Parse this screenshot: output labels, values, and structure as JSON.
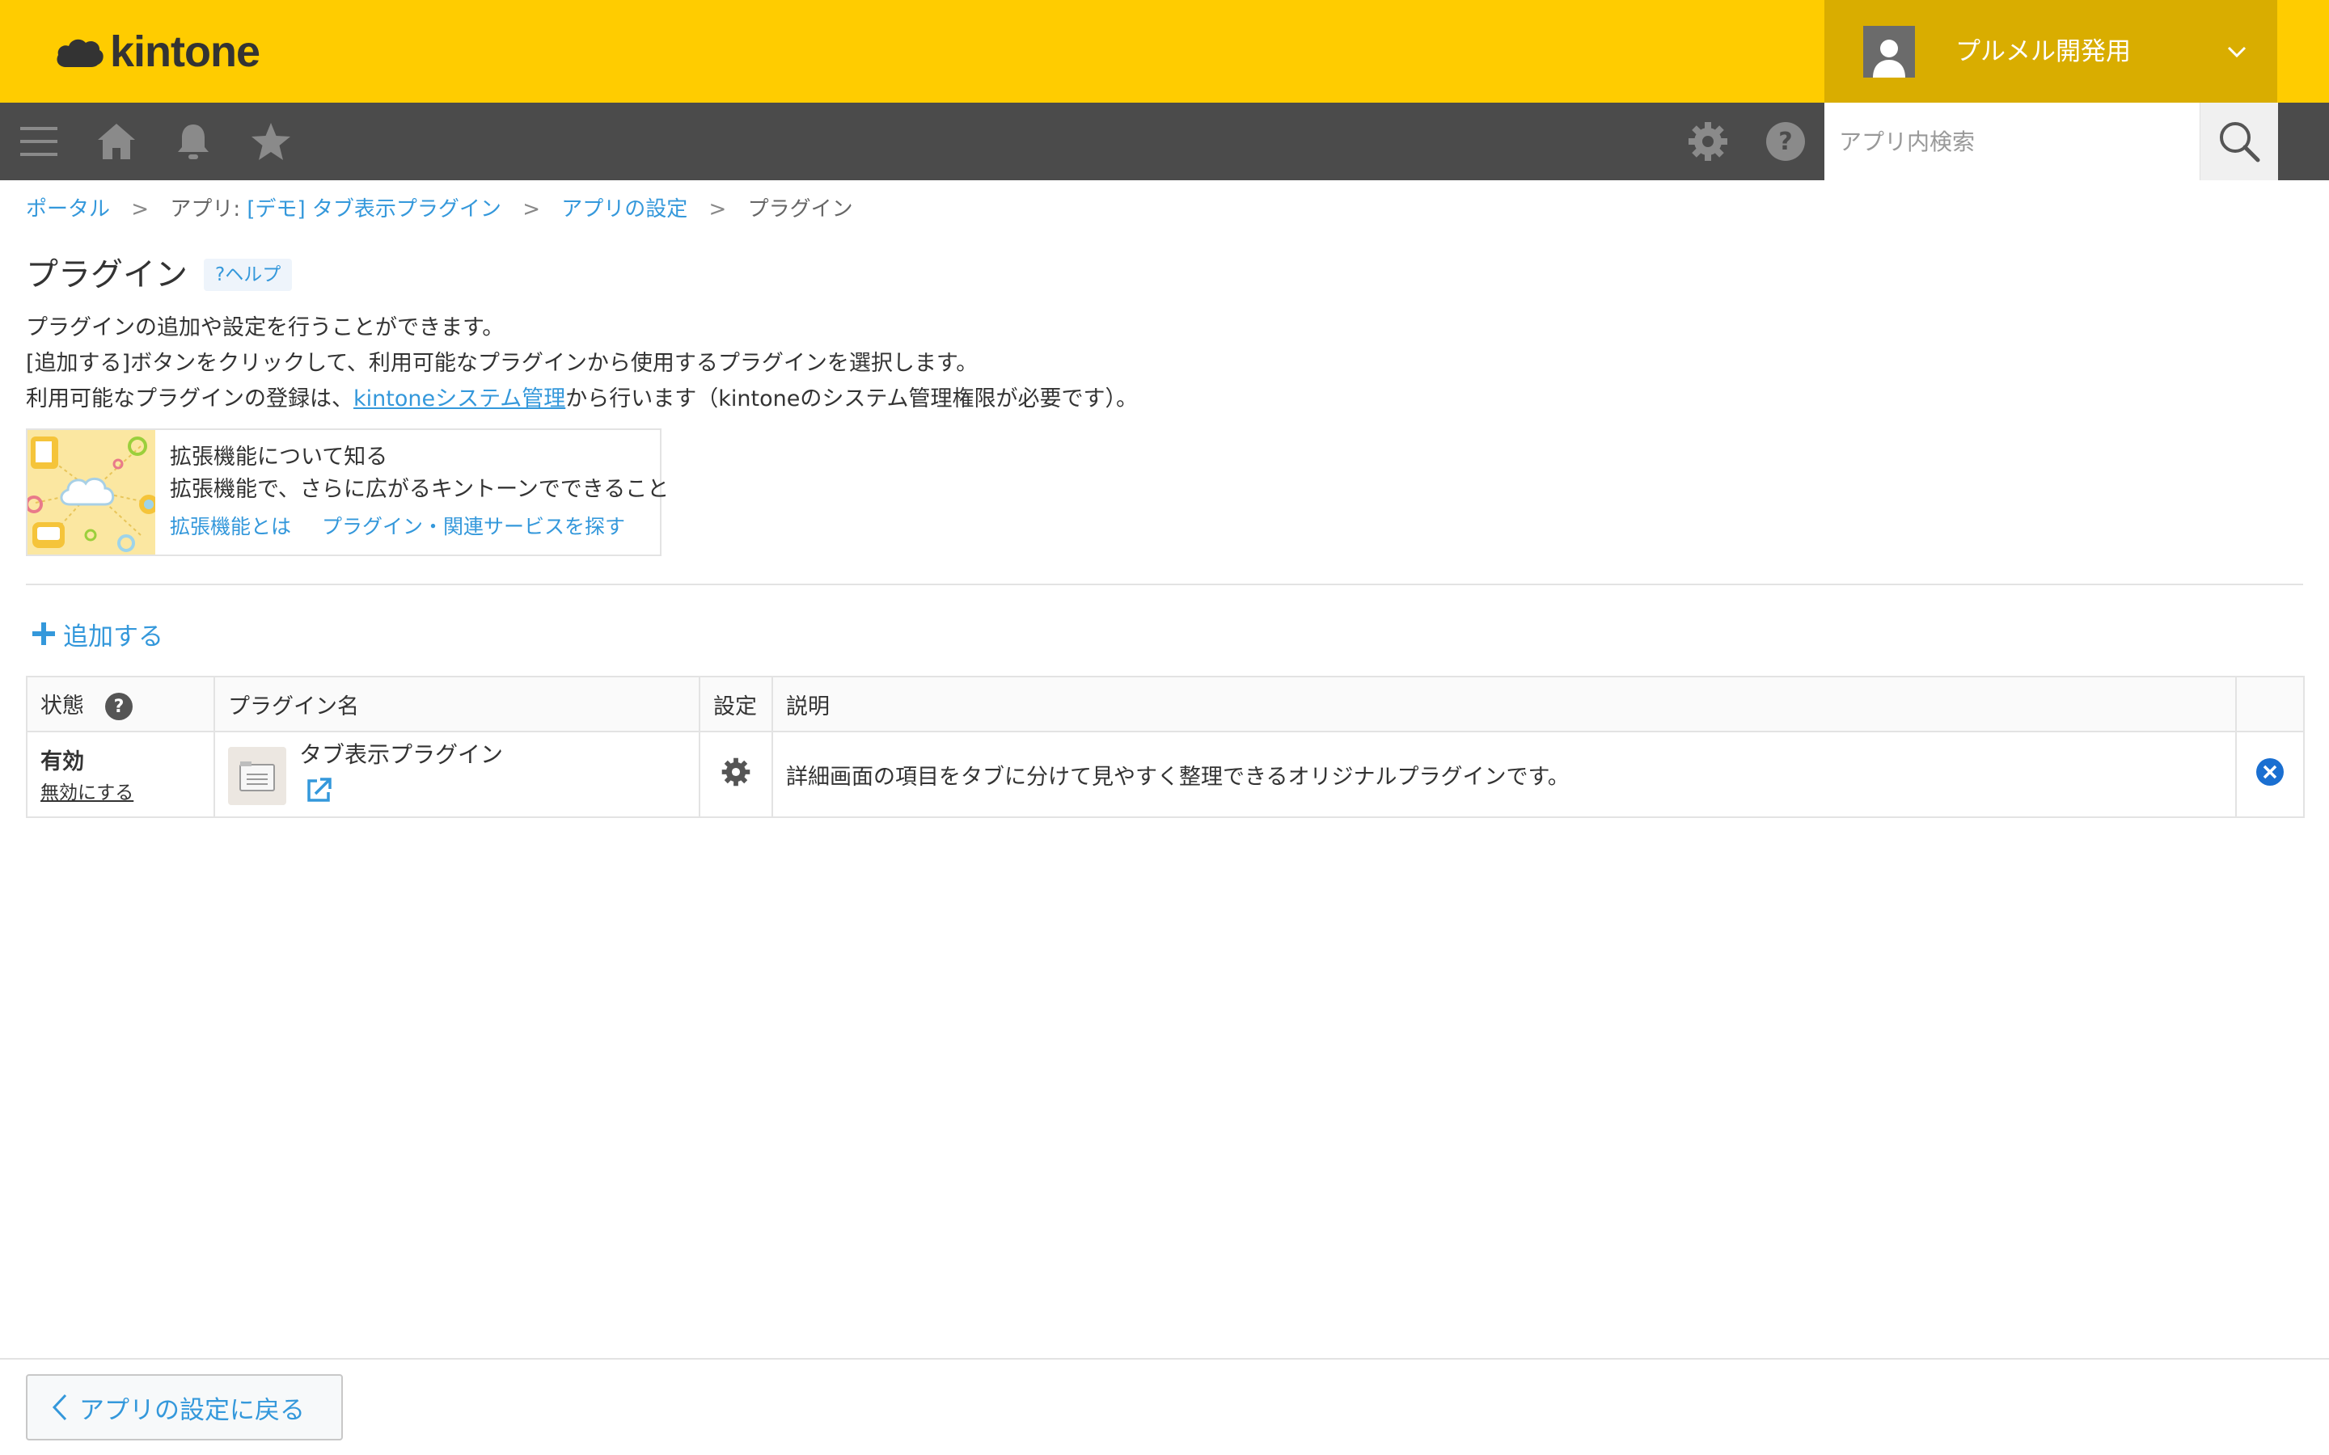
{
  "header": {
    "logo_text": "kintone",
    "account_name": "プルメル開発用",
    "brand_color": "#ffcc00",
    "icons": [
      "cloud-logo-icon",
      "user-avatar-icon",
      "chevron-down-icon"
    ]
  },
  "toolbar": {
    "icons": [
      "menu-icon",
      "home-icon",
      "bell-icon",
      "star-icon",
      "gear-icon",
      "help-icon",
      "search-icon"
    ],
    "search_placeholder": "アプリ内検索"
  },
  "breadcrumb": {
    "items": [
      "ポータル",
      "アプリ: ",
      "[デモ] タブ表示プラグイン",
      "アプリの設定",
      "プラグイン"
    ],
    "separator": ">"
  },
  "page": {
    "title": "プラグイン",
    "help_label": "?ヘルプ",
    "desc_line1": "プラグインの追加や設定を行うことができます。",
    "desc_line2": "[追加する]ボタンをクリックして、利用可能なプラグインから使用するプラグインを選択します。",
    "desc_line3_pre": "利用可能なプラグインの登録は、",
    "desc_line3_link": "kintoneシステム管理",
    "desc_line3_post": "から行います（kintoneのシステム管理権限が必要です）。"
  },
  "promo": {
    "title": "拡張機能について知る",
    "subtitle": "拡張機能で、さらに広がるキントーンでできること",
    "link1": "拡張機能とは",
    "link2": "プラグイン・関連サービスを探す"
  },
  "add_button": {
    "label": "追加する"
  },
  "table": {
    "headers": {
      "status": "状態",
      "name": "プラグイン名",
      "settings": "設定",
      "description": "説明"
    },
    "rows": [
      {
        "status": "有効",
        "toggle_label": "無効にする",
        "name": "タブ表示プラグイン",
        "description": "詳細画面の項目をタブに分けて見やすく整理できるオリジナルプラグインです。"
      }
    ]
  },
  "footer": {
    "back_label": "アプリの設定に戻る"
  },
  "colors": {
    "accent": "#3498db",
    "toolbar": "#4b4b4b",
    "account_bg": "#d9ad00"
  }
}
